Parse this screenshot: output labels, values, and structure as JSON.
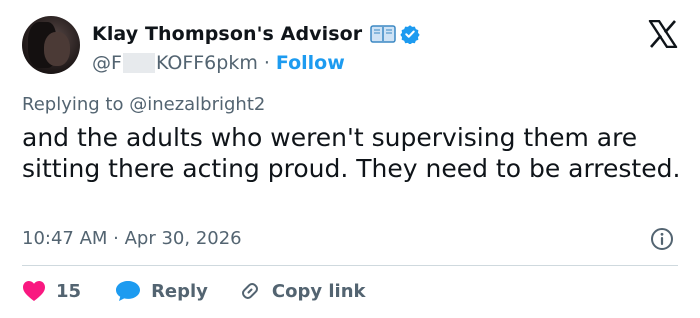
{
  "author": {
    "display_name": "Klay Thompson's Advisor",
    "handle_prefix": "@F",
    "handle_suffix": "KOFF6pkm",
    "separator": "·",
    "follow_label": "Follow"
  },
  "reply_context": {
    "prefix": "Replying to",
    "mention": "@inezalbright2"
  },
  "tweet": {
    "text": "and the adults who weren't supervising them are sitting there acting proud. They need to be arrested.",
    "timestamp": "10:47 AM · Apr 30, 2026"
  },
  "actions": {
    "like_count": "15",
    "reply_label": "Reply",
    "copy_label": "Copy link"
  },
  "colors": {
    "accent": "#1d9bf0",
    "like": "#f91880",
    "muted": "#536471",
    "text": "#0f1419"
  },
  "icons": {
    "book": "open-book-icon",
    "verified": "verified-badge-icon",
    "logo": "x-logo-icon",
    "info": "info-icon",
    "like": "heart-icon",
    "reply": "speech-bubble-icon",
    "copy": "link-icon"
  }
}
